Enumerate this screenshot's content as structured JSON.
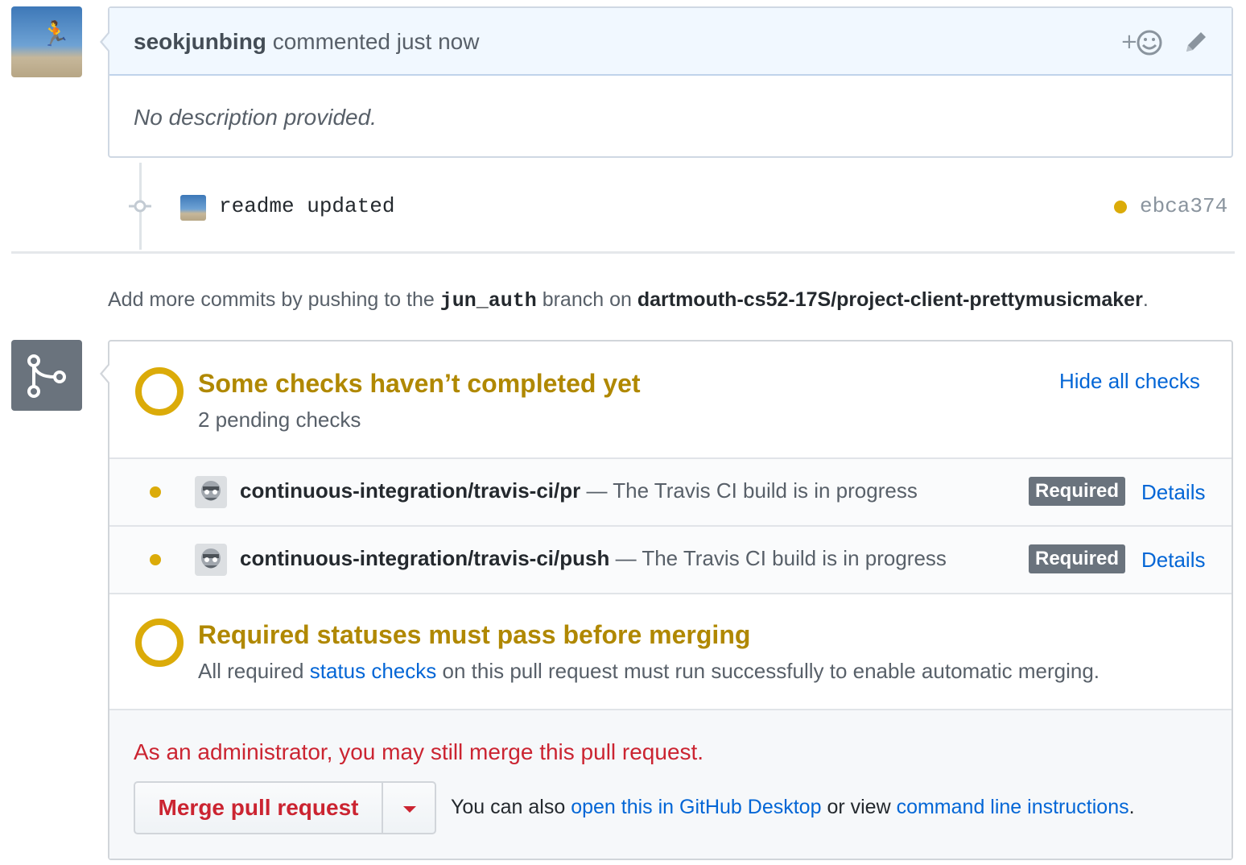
{
  "comment": {
    "author": "seokjunbing",
    "action": "commented just now",
    "body": "No description provided.",
    "reaction_icon": "add-reaction-smiley-icon",
    "edit_icon": "pencil-icon"
  },
  "commit": {
    "message": "readme updated",
    "status": "pending",
    "sha": "ebca374",
    "status_color": "#dbab09"
  },
  "push_hint": {
    "prefix": "Add more commits by pushing to the",
    "branch": "jun_auth",
    "middle": "branch on",
    "repo": "dartmouth-cs52-17S/project-client-prettymusicmaker",
    "suffix": "."
  },
  "checks": {
    "title": "Some checks haven’t completed yet",
    "subtitle": "2 pending checks",
    "hide_label": "Hide all checks",
    "items": [
      {
        "context": "continuous-integration/travis-ci/pr",
        "description": " — The Travis CI build is in progress",
        "badge": "Required",
        "details": "Details"
      },
      {
        "context": "continuous-integration/travis-ci/push",
        "description": " — The Travis CI build is in progress",
        "badge": "Required",
        "details": "Details"
      }
    ]
  },
  "required": {
    "title": "Required statuses must pass before merging",
    "text_before": "All required",
    "link": "status checks",
    "text_after": "on this pull request must run successfully to enable automatic merging."
  },
  "merge": {
    "admin_note": "As an administrator, you may still merge this pull request.",
    "button_label": "Merge pull request",
    "also_prefix": "You can also",
    "desktop_link": "open this in GitHub Desktop",
    "also_middle": "or view",
    "cli_link": "command line instructions",
    "also_suffix": "."
  },
  "colors": {
    "pending": "#dbab09",
    "pending_text": "#b08800",
    "link": "#0366d6",
    "danger": "#cb2431",
    "badge": "#6a737d"
  }
}
